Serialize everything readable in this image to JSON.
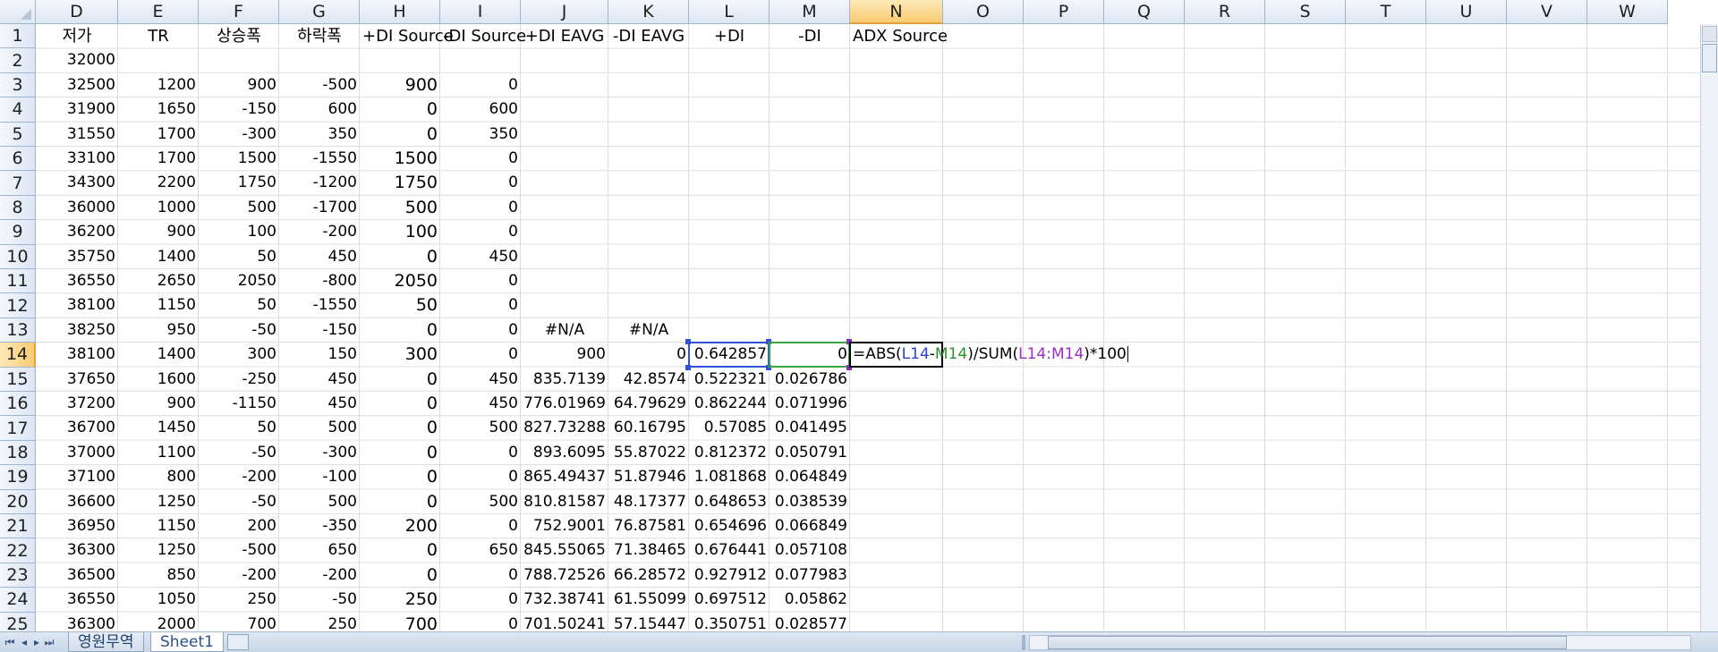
{
  "columns": [
    "D",
    "E",
    "F",
    "G",
    "H",
    "I",
    "J",
    "K",
    "L",
    "M",
    "N",
    "O",
    "P",
    "Q",
    "R",
    "S",
    "T",
    "U",
    "V",
    "W"
  ],
  "active_column": "N",
  "active_row": 14,
  "headers_row1": {
    "D": "저가",
    "E": "TR",
    "F": "상승폭",
    "G": "하락폭",
    "H": "+DI Source",
    "I": "-DI Source",
    "J": "+DI EAVG",
    "K": "-DI EAVG",
    "L": "+DI",
    "M": "-DI",
    "N": "ADX Source"
  },
  "rows": [
    {
      "r": 2,
      "D": "32000"
    },
    {
      "r": 3,
      "D": "32500",
      "E": "1200",
      "F": "900",
      "G": "-500",
      "H": "900",
      "I": "0"
    },
    {
      "r": 4,
      "D": "31900",
      "E": "1650",
      "F": "-150",
      "G": "600",
      "H": "0",
      "I": "600"
    },
    {
      "r": 5,
      "D": "31550",
      "E": "1700",
      "F": "-300",
      "G": "350",
      "H": "0",
      "I": "350"
    },
    {
      "r": 6,
      "D": "33100",
      "E": "1700",
      "F": "1500",
      "G": "-1550",
      "H": "1500",
      "I": "0"
    },
    {
      "r": 7,
      "D": "34300",
      "E": "2200",
      "F": "1750",
      "G": "-1200",
      "H": "1750",
      "I": "0"
    },
    {
      "r": 8,
      "D": "36000",
      "E": "1000",
      "F": "500",
      "G": "-1700",
      "H": "500",
      "I": "0"
    },
    {
      "r": 9,
      "D": "36200",
      "E": "900",
      "F": "100",
      "G": "-200",
      "H": "100",
      "I": "0"
    },
    {
      "r": 10,
      "D": "35750",
      "E": "1400",
      "F": "50",
      "G": "450",
      "H": "0",
      "I": "450"
    },
    {
      "r": 11,
      "D": "36550",
      "E": "2650",
      "F": "2050",
      "G": "-800",
      "H": "2050",
      "I": "0"
    },
    {
      "r": 12,
      "D": "38100",
      "E": "1150",
      "F": "50",
      "G": "-1550",
      "H": "50",
      "I": "0"
    },
    {
      "r": 13,
      "D": "38250",
      "E": "950",
      "F": "-50",
      "G": "-150",
      "H": "0",
      "I": "0",
      "J": "#N/A",
      "K": "#N/A"
    },
    {
      "r": 14,
      "D": "38100",
      "E": "1400",
      "F": "300",
      "G": "150",
      "H": "300",
      "I": "0",
      "J": "900",
      "K": "0",
      "L": "0.642857",
      "M": "0"
    },
    {
      "r": 15,
      "D": "37650",
      "E": "1600",
      "F": "-250",
      "G": "450",
      "H": "0",
      "I": "450",
      "J": "835.7139",
      "K": "42.8574",
      "L": "0.522321",
      "M": "0.026786"
    },
    {
      "r": 16,
      "D": "37200",
      "E": "900",
      "F": "-1150",
      "G": "450",
      "H": "0",
      "I": "450",
      "J": "776.01969",
      "K": "64.79629",
      "L": "0.862244",
      "M": "0.071996"
    },
    {
      "r": 17,
      "D": "36700",
      "E": "1450",
      "F": "50",
      "G": "500",
      "H": "0",
      "I": "500",
      "J": "827.73288",
      "K": "60.16795",
      "L": "0.57085",
      "M": "0.041495"
    },
    {
      "r": 18,
      "D": "37000",
      "E": "1100",
      "F": "-50",
      "G": "-300",
      "H": "0",
      "I": "0",
      "J": "893.6095",
      "K": "55.87022",
      "L": "0.812372",
      "M": "0.050791"
    },
    {
      "r": 19,
      "D": "37100",
      "E": "800",
      "F": "-200",
      "G": "-100",
      "H": "0",
      "I": "0",
      "J": "865.49437",
      "K": "51.87946",
      "L": "1.081868",
      "M": "0.064849"
    },
    {
      "r": 20,
      "D": "36600",
      "E": "1250",
      "F": "-50",
      "G": "500",
      "H": "0",
      "I": "500",
      "J": "810.81587",
      "K": "48.17377",
      "L": "0.648653",
      "M": "0.038539"
    },
    {
      "r": 21,
      "D": "36950",
      "E": "1150",
      "F": "200",
      "G": "-350",
      "H": "200",
      "I": "0",
      "J": "752.9001",
      "K": "76.87581",
      "L": "0.654696",
      "M": "0.066849"
    },
    {
      "r": 22,
      "D": "36300",
      "E": "1250",
      "F": "-500",
      "G": "650",
      "H": "0",
      "I": "650",
      "J": "845.55065",
      "K": "71.38465",
      "L": "0.676441",
      "M": "0.057108"
    },
    {
      "r": 23,
      "D": "36500",
      "E": "850",
      "F": "-200",
      "G": "-200",
      "H": "0",
      "I": "0",
      "J": "788.72526",
      "K": "66.28572",
      "L": "0.927912",
      "M": "0.077983"
    },
    {
      "r": 24,
      "D": "36550",
      "E": "1050",
      "F": "250",
      "G": "-50",
      "H": "250",
      "I": "0",
      "J": "732.38741",
      "K": "61.55099",
      "L": "0.697512",
      "M": "0.05862"
    },
    {
      "r": 25,
      "D": "36300",
      "E": "2000",
      "F": "700",
      "G": "250",
      "H": "700",
      "I": "0",
      "J": "701.50241",
      "K": "57.15447",
      "L": "0.350751",
      "M": "0.028577"
    }
  ],
  "row_numbers": [
    "1",
    "2",
    "3",
    "4",
    "5",
    "6",
    "7",
    "8",
    "9",
    "10",
    "11",
    "12",
    "13",
    "14",
    "15",
    "16",
    "17",
    "18",
    "19",
    "20",
    "21",
    "22",
    "23",
    "24",
    "25"
  ],
  "formula": {
    "cell": "N14",
    "parts": [
      {
        "text": "=ABS(",
        "color": "black"
      },
      {
        "text": "L14",
        "color": "blue"
      },
      {
        "text": "-",
        "color": "black"
      },
      {
        "text": "M14",
        "color": "green"
      },
      {
        "text": ")/SUM(",
        "color": "black"
      },
      {
        "text": "L14:M14",
        "color": "purple"
      },
      {
        "text": ")*100",
        "color": "black"
      }
    ]
  },
  "sheets": [
    {
      "label": "영원무역",
      "active": false
    },
    {
      "label": "Sheet1",
      "active": true
    }
  ],
  "nav_buttons": [
    "first-sheet",
    "prev-sheet",
    "next-sheet",
    "last-sheet"
  ],
  "colors": {
    "header_bg": "#dde6f3",
    "active_header": "#f9cb72",
    "grid_line": "#d9dee6",
    "ref_blue": "#2a45d6",
    "ref_green": "#2f8f2f",
    "ref_purple": "#9a2fc4"
  }
}
